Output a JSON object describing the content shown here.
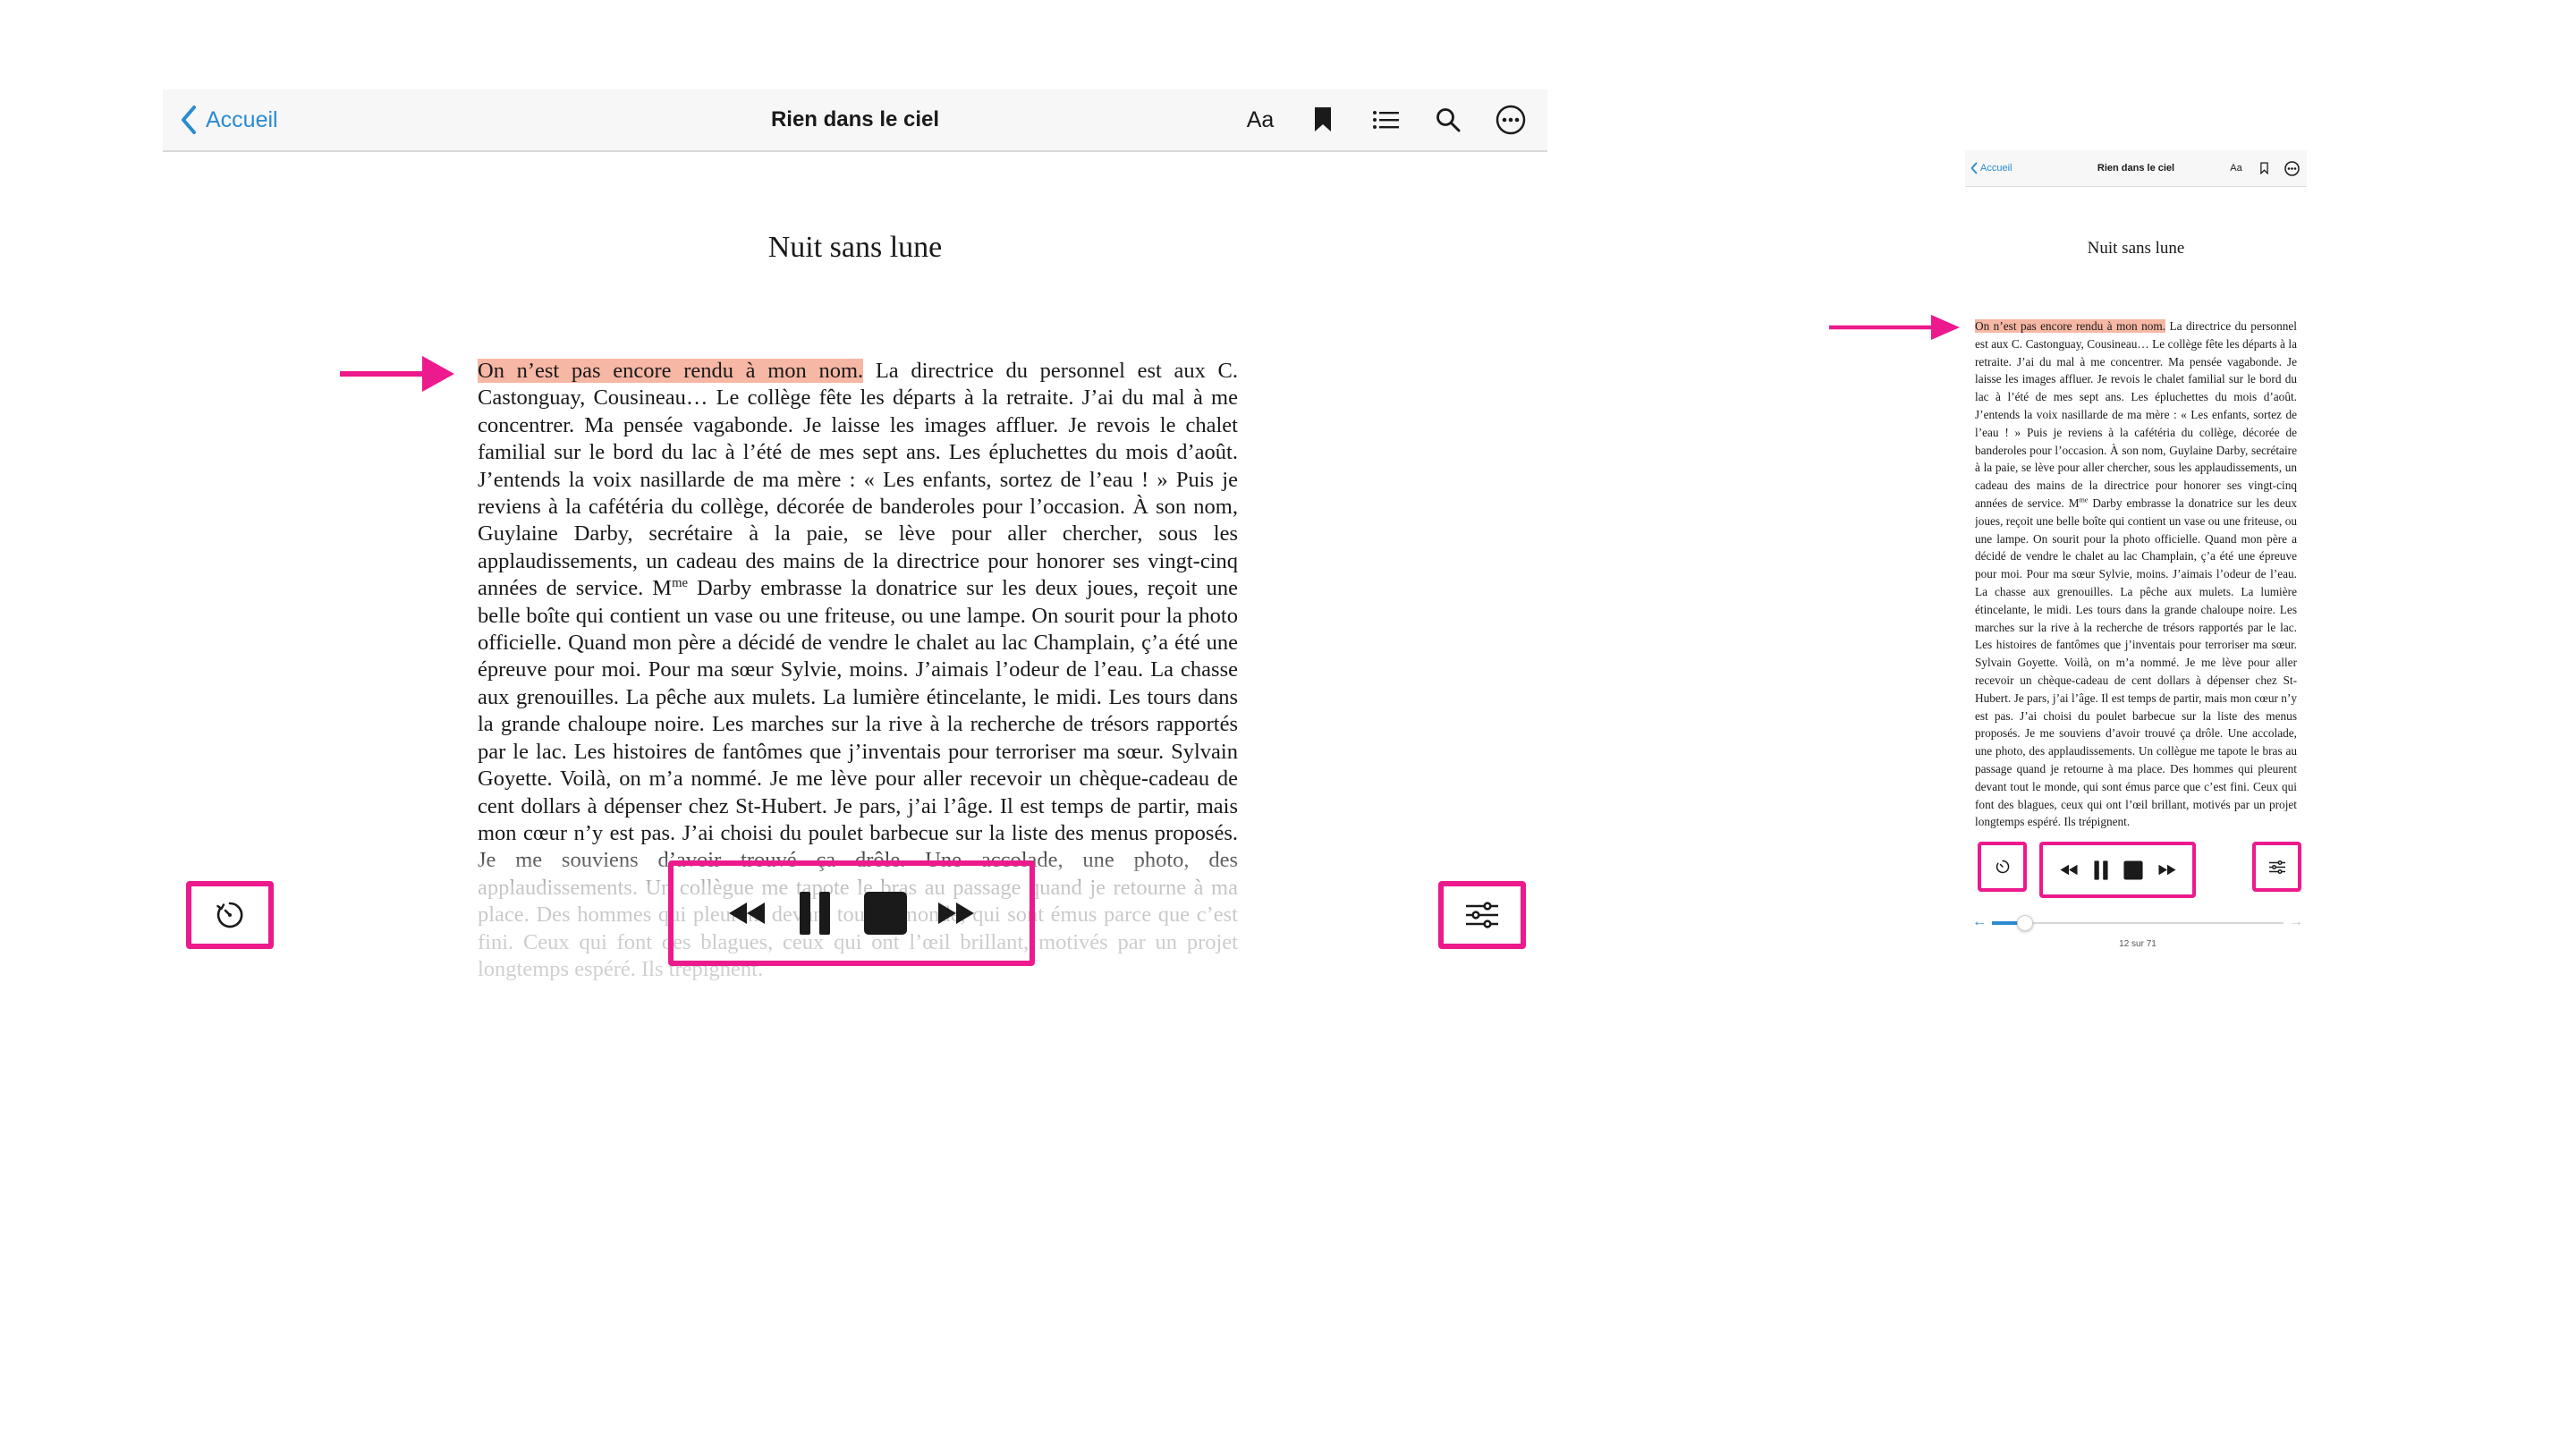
{
  "large": {
    "header": {
      "back_label": "Accueil",
      "title": "Rien dans le ciel",
      "font_button_label": "Aa"
    },
    "chapter_title": "Nuit sans lune",
    "paragraph": {
      "highlight": "On n’est pas encore rendu à mon nom.",
      "part1": " La directrice du personnel est aux C. Castonguay, Cousineau… Le collège fête les départs à la retraite. J’ai du mal à me concentrer. Ma pensée vagabonde. Je laisse les images affluer. Je revois le chalet familial sur le bord du lac à l’été de mes sept ans. Les épluchettes du mois d’août. J’entends la voix nasillarde de ma mère : « Les enfants, sortez de l’eau ! » Puis je reviens à la cafétéria du collège, décorée de banderoles pour l’occasion. À son nom, Guylaine Darby, secrétaire à la paie, se lève pour aller chercher, sous les applaudissements, un cadeau des mains de la directrice pour honorer ses vingt-cinq années de service. M",
      "sup": "me",
      "part2": " Darby embrasse la donatrice sur les deux joues, reçoit une belle boîte qui contient un vase ou une friteuse, ou une lampe. On sourit pour la photo officielle. Quand mon père a décidé de vendre le chalet au lac Champlain, ç’a été une épreuve pour moi. Pour ma sœur Sylvie, moins. J’aimais l’odeur de l’eau. La chasse aux grenouilles. La pêche aux mulets. La lumière étincelante, le midi. Les tours dans la grande chaloupe noire. Les marches sur la rive à la recherche de trésors rapportés par le lac. Les histoires de fantômes que j’inventais pour terroriser ma sœur. Sylvain Goyette. Voilà, on m’a nommé. Je me lève pour aller recevoir un chèque-cadeau de cent dollars à dépenser chez St-Hubert. Je pars, j’ai l’âge. Il est temps de partir, mais mon cœur n’y est pas. J’ai choisi du poulet barbecue sur la liste des menus proposés. Je me souviens d’avoir trouvé ça drôle. Une accolade, une photo, des applaudissements. Un collègue me tapote le bras au passage quand je retourne à ma place. Des hommes qui pleurent devant tout le monde, qui sont émus parce que c’est fini. Ceux qui font des blagues, ceux qui ont l’œil brillant, motivés par un projet longtemps espéré. Ils trépignent."
    }
  },
  "small": {
    "header": {
      "back_label": "Accueil",
      "title": "Rien dans le ciel",
      "font_button_label": "Aa"
    },
    "chapter_title": "Nuit sans lune",
    "page_indicator": "12 sur 71",
    "progress": 0.11
  },
  "colors": {
    "accent": "#2a8bd0",
    "highlight": "#f6b7a4",
    "annotation": "#ec1a8c"
  },
  "icons": [
    "chevron-left-icon",
    "bookmark-icon",
    "list-icon",
    "search-icon",
    "more-icon",
    "sleep-timer-icon",
    "rewind-icon",
    "pause-icon",
    "stop-icon",
    "fast-forward-icon",
    "settings-sliders-icon",
    "arrow-right-annotation"
  ]
}
